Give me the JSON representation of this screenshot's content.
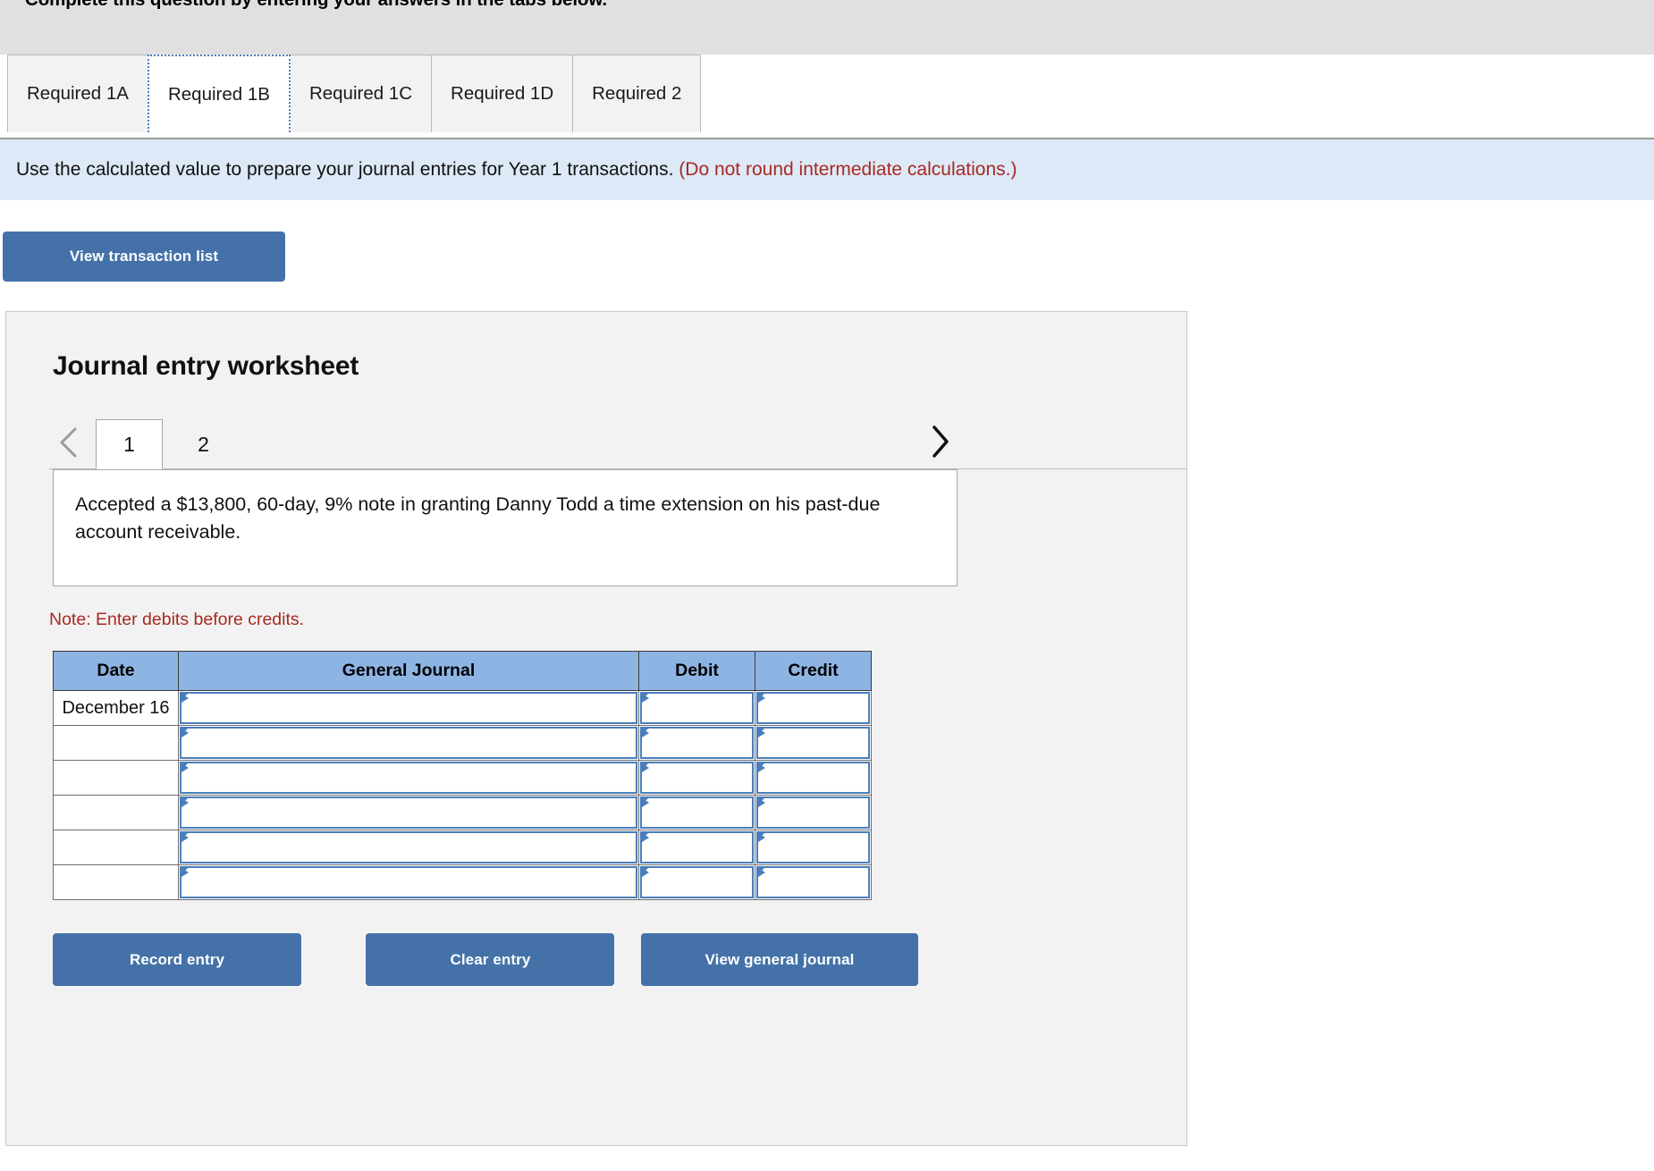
{
  "header": {
    "instruction": "Complete this question by entering your answers in the tabs below."
  },
  "tabs": [
    {
      "label": "Required 1A",
      "active": false
    },
    {
      "label": "Required 1B",
      "active": true
    },
    {
      "label": "Required 1C",
      "active": false
    },
    {
      "label": "Required 1D",
      "active": false
    },
    {
      "label": "Required 2",
      "active": false
    }
  ],
  "banner": {
    "text": "Use the calculated value to prepare your journal entries for Year 1 transactions.",
    "warning": "(Do not round intermediate calculations.)",
    "background_color": "#dde9f7",
    "warning_color": "#a82a21"
  },
  "toolbar": {
    "view_transaction_list_label": "View transaction list"
  },
  "worksheet": {
    "title": "Journal entry worksheet",
    "pager": {
      "prev_icon": "chevron-left-icon",
      "next_icon": "chevron-right-icon",
      "entries": [
        {
          "label": "1",
          "active": true
        },
        {
          "label": "2",
          "active": false
        }
      ]
    },
    "description": "Accepted a $13,800, 60-day, 9% note in granting Danny Todd a time extension on his past-due account receivable.",
    "note": "Note: Enter debits before credits.",
    "table": {
      "columns": [
        "Date",
        "General Journal",
        "Debit",
        "Credit"
      ],
      "header_color": "#8eb4e3",
      "rows": [
        {
          "date": "December 16",
          "general_journal": "",
          "debit": "",
          "credit": ""
        },
        {
          "date": "",
          "general_journal": "",
          "debit": "",
          "credit": ""
        },
        {
          "date": "",
          "general_journal": "",
          "debit": "",
          "credit": ""
        },
        {
          "date": "",
          "general_journal": "",
          "debit": "",
          "credit": ""
        },
        {
          "date": "",
          "general_journal": "",
          "debit": "",
          "credit": ""
        },
        {
          "date": "",
          "general_journal": "",
          "debit": "",
          "credit": ""
        }
      ]
    },
    "actions": {
      "record_entry_label": "Record entry",
      "clear_entry_label": "Clear entry",
      "view_general_journal_label": "View general journal"
    }
  },
  "colors": {
    "button_blue": "#4472a8",
    "accent_blue": "#4a7ebb",
    "top_band": "#e0e0e0",
    "panel_bg": "#f2f2f2"
  }
}
